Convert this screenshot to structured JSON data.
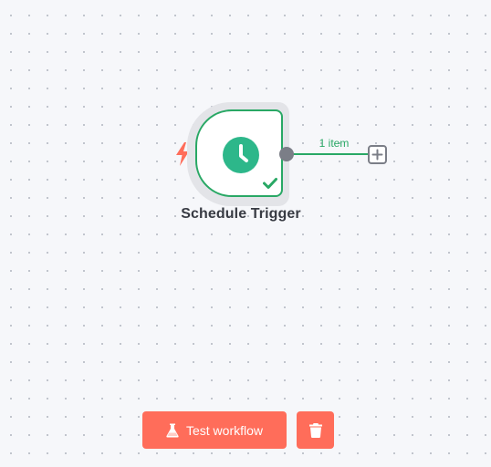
{
  "node": {
    "label": "Schedule Trigger",
    "icon": "clock-icon",
    "trigger_icon": "lightning-bolt-icon",
    "status_icon": "checkmark-icon",
    "border_color": "#29a865",
    "icon_color": "#2db78a",
    "trigger_color": "#ff6d5a"
  },
  "connection": {
    "label": "1 item",
    "color": "#29a865",
    "add_icon": "plus-icon"
  },
  "toolbar": {
    "test_workflow_label": "Test workflow",
    "test_icon": "flask-icon",
    "delete_icon": "trash-icon",
    "button_color": "#ff6d5a"
  }
}
